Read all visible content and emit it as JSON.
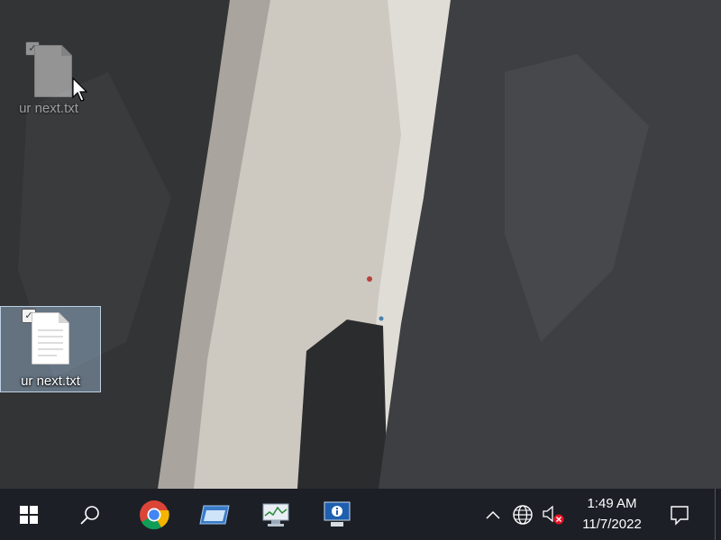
{
  "desktop": {
    "icons": [
      {
        "label": "ur next.txt",
        "checked": true,
        "state": "dragging-ghost"
      },
      {
        "label": "ur next.txt",
        "checked": true,
        "state": "selected"
      }
    ],
    "checkmark": "✓"
  },
  "taskbar": {
    "start_icon": "windows-logo-icon",
    "search_icon": "search-icon",
    "apps": [
      {
        "icon": "chrome-icon"
      },
      {
        "icon": "window-app-icon"
      },
      {
        "icon": "performance-monitor-icon"
      },
      {
        "icon": "system-info-icon"
      }
    ],
    "tray": {
      "chevron_icon": "chevron-up-icon",
      "network_icon": "globe-network-icon",
      "volume_icon": "volume-muted-icon"
    },
    "clock": {
      "time": "1:49 AM",
      "date": "11/7/2022"
    },
    "notification_icon": "notification-icon"
  },
  "colors": {
    "taskbar_bg": "#1c1f26",
    "selection_bg": "#a0bedc",
    "text": "#ffffff"
  }
}
